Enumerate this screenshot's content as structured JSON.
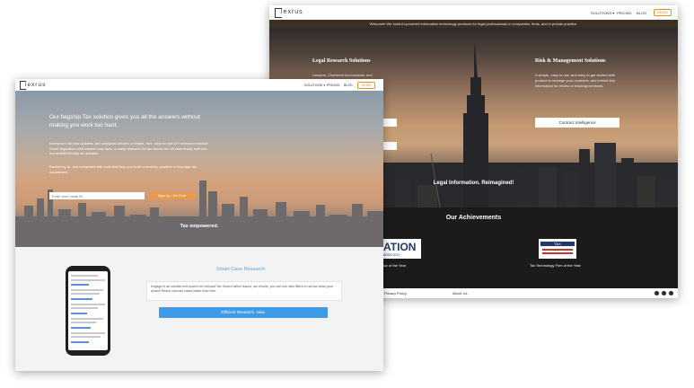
{
  "back_window": {
    "logo": "lexrus",
    "nav": {
      "solutions": "SOLUTIONS ▾",
      "pricing": "PRICING",
      "blog": "BLOG",
      "demo": "DEMO"
    },
    "banner": "Welcome! We build AI-powered information technology products for legal professionals in companies, firms, and in private practice.",
    "legal": {
      "title": "Legal Research Solutions",
      "text": "Lawyers, Chartered Accountants, and",
      "text2": "Tax professionals...",
      "button1": "",
      "button2": ""
    },
    "risk": {
      "title": "Risk & Management Solutions",
      "text": "A simple, easy to use, and easy to get started with product to manage your contracts, and extract key information for review or tracking contracts.",
      "button": "Contract Intelligence"
    },
    "tagline": "Legal Information. Reimagined!",
    "achievements": {
      "title": "Our Achievements",
      "award1_logo": "ATION",
      "award1_sub": "ARDS 2019",
      "award1_label": "ator of the Year",
      "award2_logo": "TAX",
      "award2_label": "Tax Technology Firm of the Year"
    },
    "footer": {
      "privacy": "Privacy Policy",
      "about": "About Us"
    }
  },
  "front_window": {
    "logo": "lexrus",
    "nav": {
      "solutions": "SOLUTIONS ▾",
      "pricing": "PRICING",
      "blog": "BLOG",
      "demo": "DEMO"
    },
    "hero": {
      "heading": "Our flagship Tax solution gives you all the answers without making you work too hard.",
      "para1": "Everyone's tax law updates, and analyzed articles, a simple, free, easy to use DIY research solution. Smart legislation with related case laws, a ready reckoner for tax issues are all seamlessly built into our mobile-friendly tax solution.",
      "para2": "Backed by AI, and integrated with tools that help you build a smarter, practice or leverage tax department.",
      "input_placeholder": "Enter your email ID",
      "signup": "Sign up - It's Free",
      "empowered": "Tax empowered."
    },
    "smart_case": {
      "title": "Smart Case Research",
      "text": "Engage in an intuitive text search for relevant Tax Search within issues, tax results, you can use click filters to narrow down your search.Reach relevant cases faster than ever.",
      "button": "Efficient Research. Now."
    }
  },
  "colors": {
    "accent_orange": "#e89a4e",
    "accent_blue": "#3f9be5",
    "dark": "#1b1b1b"
  }
}
